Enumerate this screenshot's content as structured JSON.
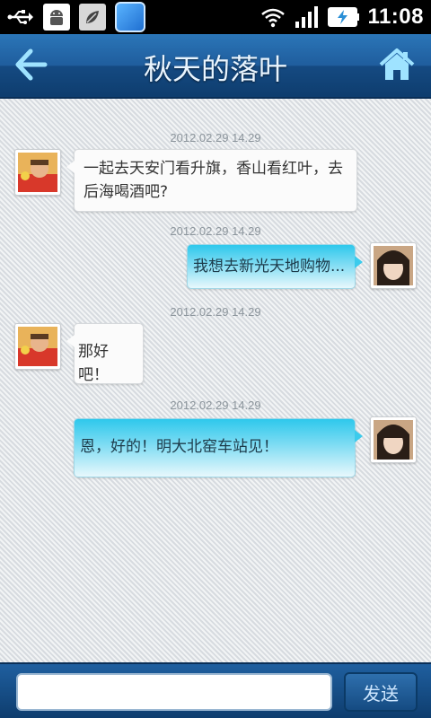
{
  "status_bar": {
    "time": "11:08",
    "icons_left": [
      "usb-icon",
      "android-debug-icon",
      "leaf-notification-icon",
      "app-notification-icon"
    ],
    "icons_right": [
      "wifi-icon",
      "signal-icon",
      "battery-charging-icon"
    ]
  },
  "header": {
    "title": "秋天的落叶",
    "back_icon": "back-arrow-icon",
    "home_icon": "home-icon"
  },
  "messages": [
    {
      "side": "left",
      "timestamp": "2012.02.29 14.29",
      "text_line1": "一起去天安门看升旗，香山看红叶，去",
      "text_line2": "后海喝酒吧?"
    },
    {
      "side": "right",
      "timestamp": "2012.02.29 14.29",
      "text": "我想去新光天地购物..."
    },
    {
      "side": "left",
      "timestamp": "2012.02.29 14.29",
      "text": "那好吧！"
    },
    {
      "side": "right",
      "timestamp": "2012.02.29 14.29",
      "text": "恩，好的！明大北窑车站见！"
    }
  ],
  "composer": {
    "input_value": "",
    "send_label": "发送"
  },
  "colors": {
    "header_blue": "#1f5d9d",
    "incoming_bubble": "#fbfbfb",
    "outgoing_bubble": "#2ec8ec",
    "timestamp_gray": "#8c959c"
  }
}
